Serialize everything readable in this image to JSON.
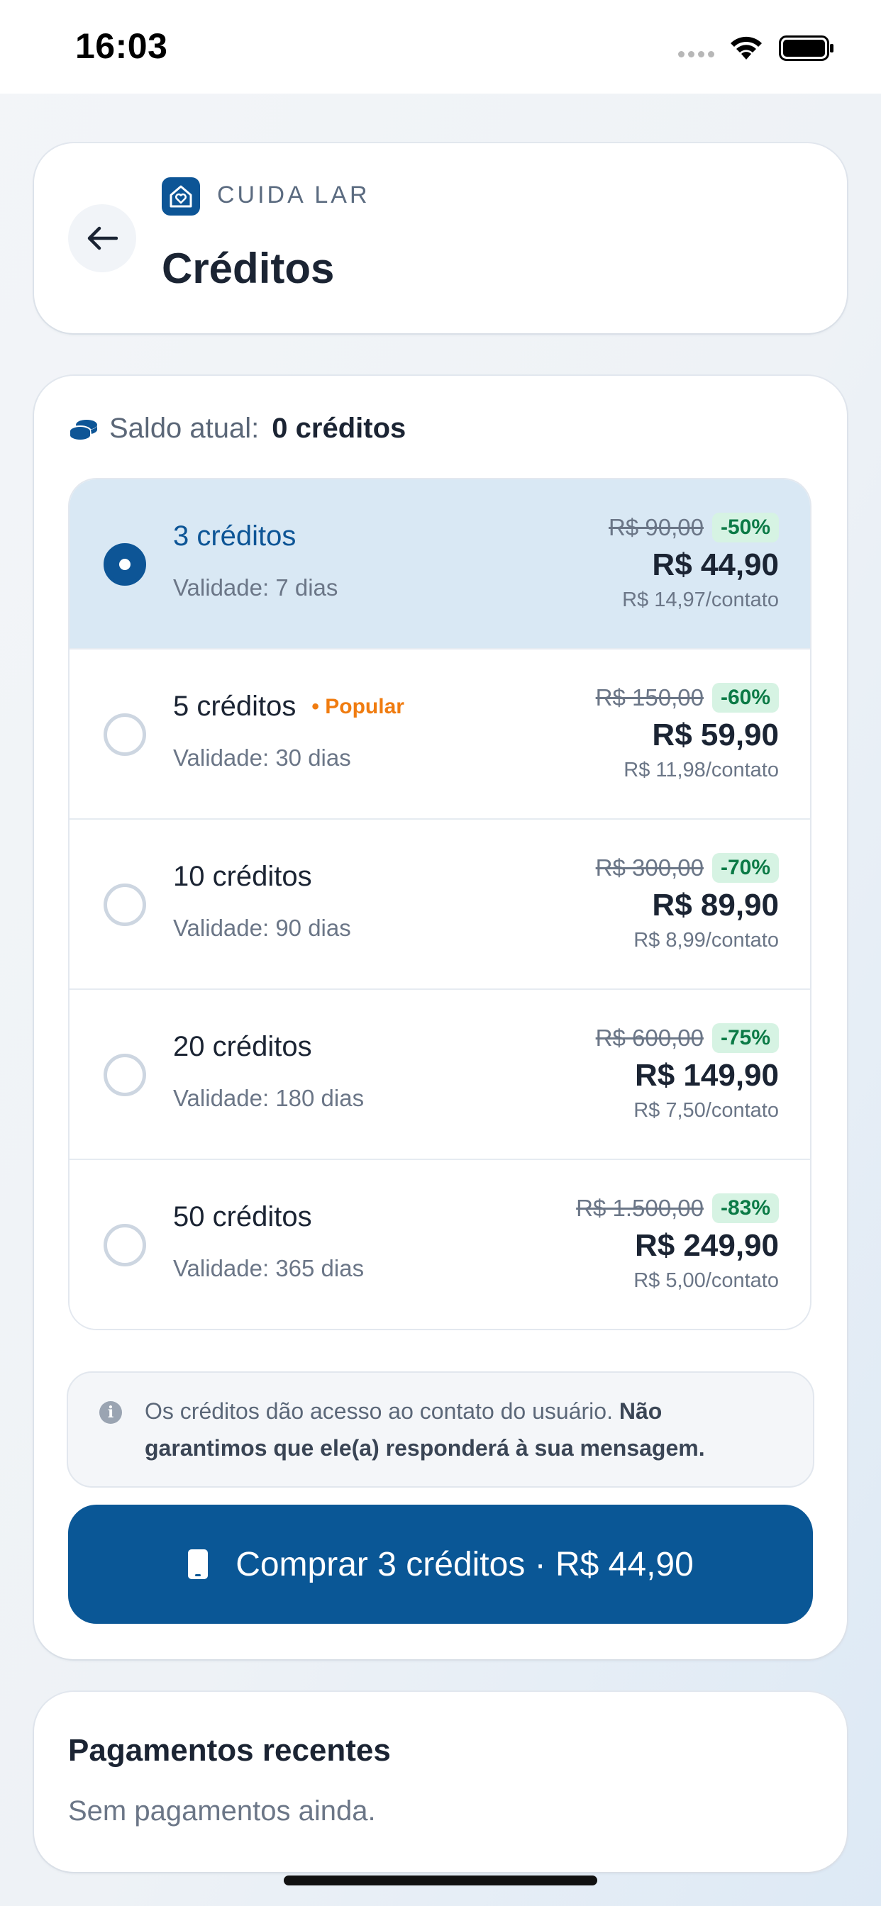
{
  "status_bar": {
    "time": "16:03"
  },
  "header": {
    "brand": "CUIDA LAR",
    "title": "Créditos"
  },
  "balance": {
    "label": "Saldo atual:",
    "value": "0 créditos"
  },
  "packages": [
    {
      "title": "3 créditos",
      "badge": "",
      "validity": "Validade: 7 dias",
      "old_price": "R$ 90,00",
      "discount": "-50%",
      "price": "R$ 44,90",
      "per_contact": "R$ 14,97/contato",
      "selected": true
    },
    {
      "title": "5 créditos",
      "badge": "• Popular",
      "validity": "Validade: 30 dias",
      "old_price": "R$ 150,00",
      "discount": "-60%",
      "price": "R$ 59,90",
      "per_contact": "R$ 11,98/contato",
      "selected": false
    },
    {
      "title": "10 créditos",
      "badge": "",
      "validity": "Validade: 90 dias",
      "old_price": "R$ 300,00",
      "discount": "-70%",
      "price": "R$ 89,90",
      "per_contact": "R$ 8,99/contato",
      "selected": false
    },
    {
      "title": "20 créditos",
      "badge": "",
      "validity": "Validade: 180 dias",
      "old_price": "R$ 600,00",
      "discount": "-75%",
      "price": "R$ 149,90",
      "per_contact": "R$ 7,50/contato",
      "selected": false
    },
    {
      "title": "50 créditos",
      "badge": "",
      "validity": "Validade: 365 dias",
      "old_price": "R$ 1.500,00",
      "discount": "-83%",
      "price": "R$ 249,90",
      "per_contact": "R$ 5,00/contato",
      "selected": false
    }
  ],
  "info": {
    "text": "Os créditos dão acesso ao contato do usuário.",
    "bold_text": "Não garantimos que ele(a) responderá à sua mensagem."
  },
  "buy_button": {
    "label": "Comprar 3 créditos · R$ 44,90"
  },
  "payments": {
    "title": "Pagamentos recentes",
    "empty": "Sem pagamentos ainda."
  },
  "colors": {
    "primary": "#0a5796",
    "selected_bg": "#d9e8f4",
    "popular": "#f07c10",
    "discount_text": "#0b7a46",
    "discount_bg": "#d6f3e3"
  },
  "icons": [
    "wifi-icon",
    "battery-icon",
    "back-arrow-icon",
    "house-heart-icon",
    "coins-icon",
    "info-icon",
    "phone-icon"
  ]
}
